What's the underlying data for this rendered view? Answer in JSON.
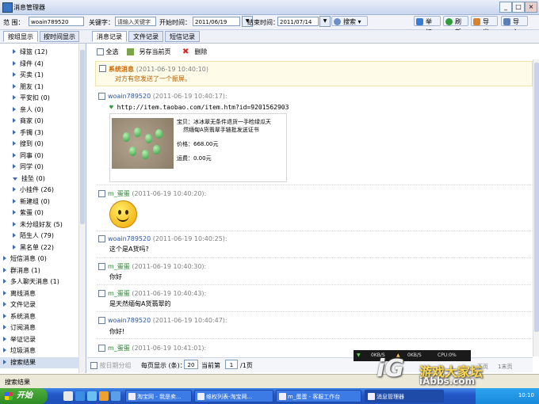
{
  "window": {
    "title": "消息管理器",
    "min": "_",
    "max": "□",
    "close": "×"
  },
  "toolbar": {
    "scope_label": "范 围：",
    "scope_value": "woain789520",
    "keyword_label": "关键字：",
    "keyword_placeholder": "请输入关键字",
    "start_label": "开始时间：",
    "start_value": "2011/06/19",
    "end_label": "结束时间：",
    "end_value": "2011/07/14",
    "search": "搜索",
    "report": "举证",
    "refresh": "刷新",
    "export": "导出",
    "import": "导入",
    "colors": {
      "report": "#3a7bd5",
      "refresh": "#2f9e3a",
      "export": "#d9822b",
      "import": "#5a7fb8"
    }
  },
  "view_tabs": [
    "按组显示",
    "按时间显示"
  ],
  "record_tabs": [
    "消息记录",
    "文件记录",
    "短信记录"
  ],
  "sidebar": {
    "groups": [
      {
        "label": "绿篮 (12)",
        "exp": false
      },
      {
        "label": "绿件 (4)",
        "exp": false
      },
      {
        "label": "买卖 (1)",
        "exp": false
      },
      {
        "label": "朋友 (1)",
        "exp": false
      },
      {
        "label": "平安扣 (0)",
        "exp": false
      },
      {
        "label": "亲人 (0)",
        "exp": false
      },
      {
        "label": "商家 (0)",
        "exp": false
      },
      {
        "label": "手镯 (3)",
        "exp": false
      },
      {
        "label": "搜到 (0)",
        "exp": false
      },
      {
        "label": "同事 (0)",
        "exp": false
      },
      {
        "label": "同学 (0)",
        "exp": false
      },
      {
        "label": "挂坠 (0)",
        "exp": true
      },
      {
        "label": "小挂件 (26)",
        "exp": false
      },
      {
        "label": "新建组 (0)",
        "exp": false
      },
      {
        "label": "紫蛋 (0)",
        "exp": false
      },
      {
        "label": "未分组好友 (5)",
        "exp": false
      },
      {
        "label": "陌生人 (79)",
        "exp": false
      },
      {
        "label": "黑名单 (22)",
        "exp": false
      }
    ],
    "categories": [
      "短信消息 (0)",
      "群消息 (1)",
      "多人聊天消息 (1)",
      "离线消息",
      "文件记录",
      "系统消息",
      "订阅消息",
      "举证记录",
      "垃圾消息",
      "搜索结果"
    ]
  },
  "actions": {
    "select_all": "全选",
    "save_page": "另存当前页",
    "delete": "删除"
  },
  "system_msg": {
    "title": "系统消息",
    "time": "(2011-06-19 10:40:10)",
    "body": "对方有您发送了一个振屏。"
  },
  "messages": [
    {
      "sender": "woain789520",
      "time": "(2011-06-19 10:40:17):",
      "link": "http://item.taobao.com/item.htm?id=9201562903",
      "card": {
        "line1": "宝贝：冰冰翠无条件退货一手睑绿瓜天",
        "line2": "然缅甸A货翡翠手链批发送证书",
        "price": "价格：668.00元",
        "ship": "运费：0.00元"
      }
    },
    {
      "sender": "m_蛋蛋",
      "time": "(2011-06-19 10:40:20):",
      "text": ""
    },
    {
      "sender": "woain789520",
      "time": "(2011-06-19 10:40:25):",
      "text": "这个是A货吗?"
    },
    {
      "sender": "m_蛋蛋",
      "time": "(2011-06-19 10:40:30):",
      "text": "你好"
    },
    {
      "sender": "m_蛋蛋",
      "time": "(2011-06-19 10:40:43):",
      "text": "是天然缅甸A货翡翠的"
    },
    {
      "sender": "woain789520",
      "time": "(2011-06-19 10:40:47):",
      "text": "你好!"
    },
    {
      "sender": "m_蛋蛋",
      "time": "(2011-06-19 10:41:01):",
      "text": ""
    }
  ],
  "pager": {
    "by_date": "按日期分组",
    "per_page_label": "每页显示 (条)：",
    "per_page": "20",
    "current_label": "当前第",
    "current": "1",
    "total": "/1页",
    "prev": "下页",
    "next": "1末页"
  },
  "netmon": {
    "down": "0KB/S",
    "up": "0KB/S",
    "cpu": "CPU:0%"
  },
  "status": {
    "text": "搜索结果"
  },
  "taskbar": {
    "start": "开始",
    "buttons": [
      "淘宝网 - 我是卖...",
      "维权列表-淘宝网...",
      "m_蛋蛋 - 客服工作台",
      "消息管理器"
    ],
    "clock": "10:10"
  },
  "watermark": {
    "logo": "iG",
    "zh": "游戏大家坛",
    "en": "iAbbs.com"
  }
}
